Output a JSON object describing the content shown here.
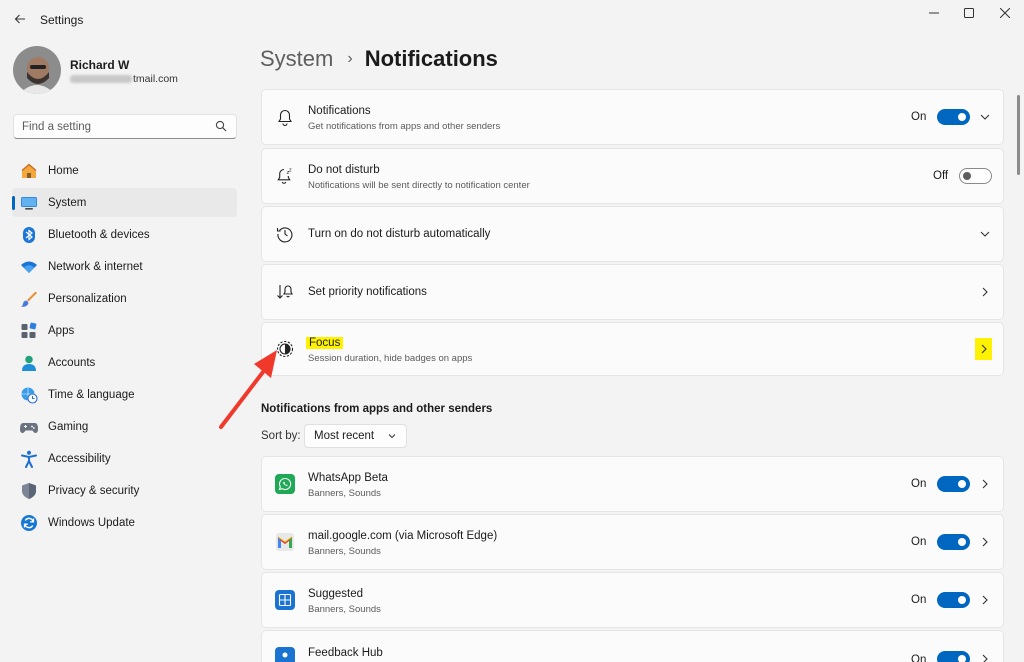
{
  "window": {
    "title": "Settings"
  },
  "user": {
    "name": "Richard W",
    "email_suffix": "tmail.com"
  },
  "search": {
    "placeholder": "Find a setting"
  },
  "sidebar": {
    "items": [
      {
        "label": "Home",
        "icon": "home-icon"
      },
      {
        "label": "System",
        "icon": "system-icon",
        "active": true
      },
      {
        "label": "Bluetooth & devices",
        "icon": "bluetooth-icon"
      },
      {
        "label": "Network & internet",
        "icon": "wifi-icon"
      },
      {
        "label": "Personalization",
        "icon": "brush-icon"
      },
      {
        "label": "Apps",
        "icon": "apps-icon"
      },
      {
        "label": "Accounts",
        "icon": "accounts-icon"
      },
      {
        "label": "Time & language",
        "icon": "globe-clock-icon"
      },
      {
        "label": "Gaming",
        "icon": "gamepad-icon"
      },
      {
        "label": "Accessibility",
        "icon": "accessibility-icon"
      },
      {
        "label": "Privacy & security",
        "icon": "shield-icon"
      },
      {
        "label": "Windows Update",
        "icon": "update-icon"
      }
    ]
  },
  "breadcrumb": {
    "parent": "System",
    "separator": "›",
    "current": "Notifications"
  },
  "settings": {
    "notifications": {
      "title": "Notifications",
      "subtitle": "Get notifications from apps and other senders",
      "state": "On"
    },
    "dnd": {
      "title": "Do not disturb",
      "subtitle": "Notifications will be sent directly to notification center",
      "state": "Off"
    },
    "auto_dnd": {
      "title": "Turn on do not disturb automatically"
    },
    "priority": {
      "title": "Set priority notifications"
    },
    "focus": {
      "title": "Focus",
      "subtitle": "Session duration, hide badges on apps"
    }
  },
  "apps_section": {
    "heading": "Notifications from apps and other senders",
    "sort_label": "Sort by:",
    "sort_value": "Most recent",
    "apps": [
      {
        "name": "WhatsApp Beta",
        "detail": "Banners, Sounds",
        "state": "On",
        "icon": "whatsapp-icon"
      },
      {
        "name": "mail.google.com (via Microsoft Edge)",
        "detail": "Banners, Sounds",
        "state": "On",
        "icon": "gmail-icon"
      },
      {
        "name": "Suggested",
        "detail": "Banners, Sounds",
        "state": "On",
        "icon": "suggested-icon"
      },
      {
        "name": "Feedback Hub",
        "detail": "",
        "state": "On",
        "icon": "feedback-hub-icon"
      }
    ]
  },
  "colors": {
    "accent": "#0067c0",
    "highlight": "#fff200",
    "annotation_arrow": "#f0392b"
  }
}
